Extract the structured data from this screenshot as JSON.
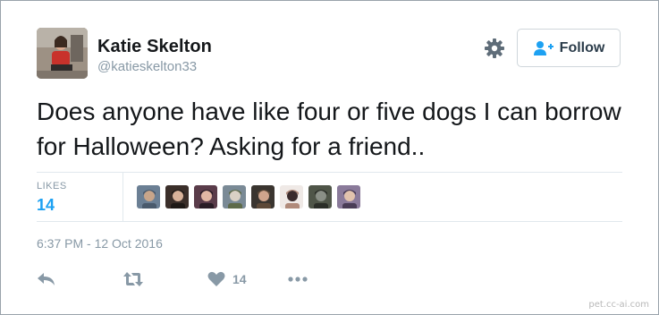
{
  "user": {
    "name": "Katie Skelton",
    "handle": "@katieskelton33"
  },
  "follow_button": {
    "label": "Follow"
  },
  "tweet": {
    "text": "Does anyone have like four or five dogs I can borrow for Halloween? Asking for a friend..",
    "timestamp": "6:37 PM - 12 Oct 2016"
  },
  "stats": {
    "likes_label": "LIKES",
    "likes_count": "14"
  },
  "actions": {
    "like_count": "14"
  },
  "watermark": "pet.cc-ai.com",
  "colors": {
    "accent": "#1da1f2",
    "muted": "#8899a6",
    "text": "#14171a",
    "border": "#e1e8ed"
  },
  "likers": [
    {
      "icon": "liker-avatar-1",
      "colors": [
        "#6b7f94",
        "#c8a58a",
        "#4a5a6c"
      ]
    },
    {
      "icon": "liker-avatar-2",
      "colors": [
        "#3b2f2a",
        "#d8b29a",
        "#1f1a17"
      ]
    },
    {
      "icon": "liker-avatar-3",
      "colors": [
        "#5a3c4a",
        "#e1b7a4",
        "#2a1d26"
      ]
    },
    {
      "icon": "liker-avatar-4",
      "colors": [
        "#7a8a96",
        "#d9d0c4",
        "#5e6b4a"
      ]
    },
    {
      "icon": "liker-avatar-5",
      "colors": [
        "#3a3530",
        "#cfa48c",
        "#5d4938"
      ]
    },
    {
      "icon": "liker-avatar-6",
      "colors": [
        "#efe9e6",
        "#3a2b2c",
        "#b08a7a"
      ]
    },
    {
      "icon": "liker-avatar-7",
      "colors": [
        "#4f5548",
        "#8a8f86",
        "#2b2e28"
      ]
    },
    {
      "icon": "liker-avatar-8",
      "colors": [
        "#8a7a9a",
        "#e2c3ad",
        "#4a3d56"
      ]
    }
  ]
}
